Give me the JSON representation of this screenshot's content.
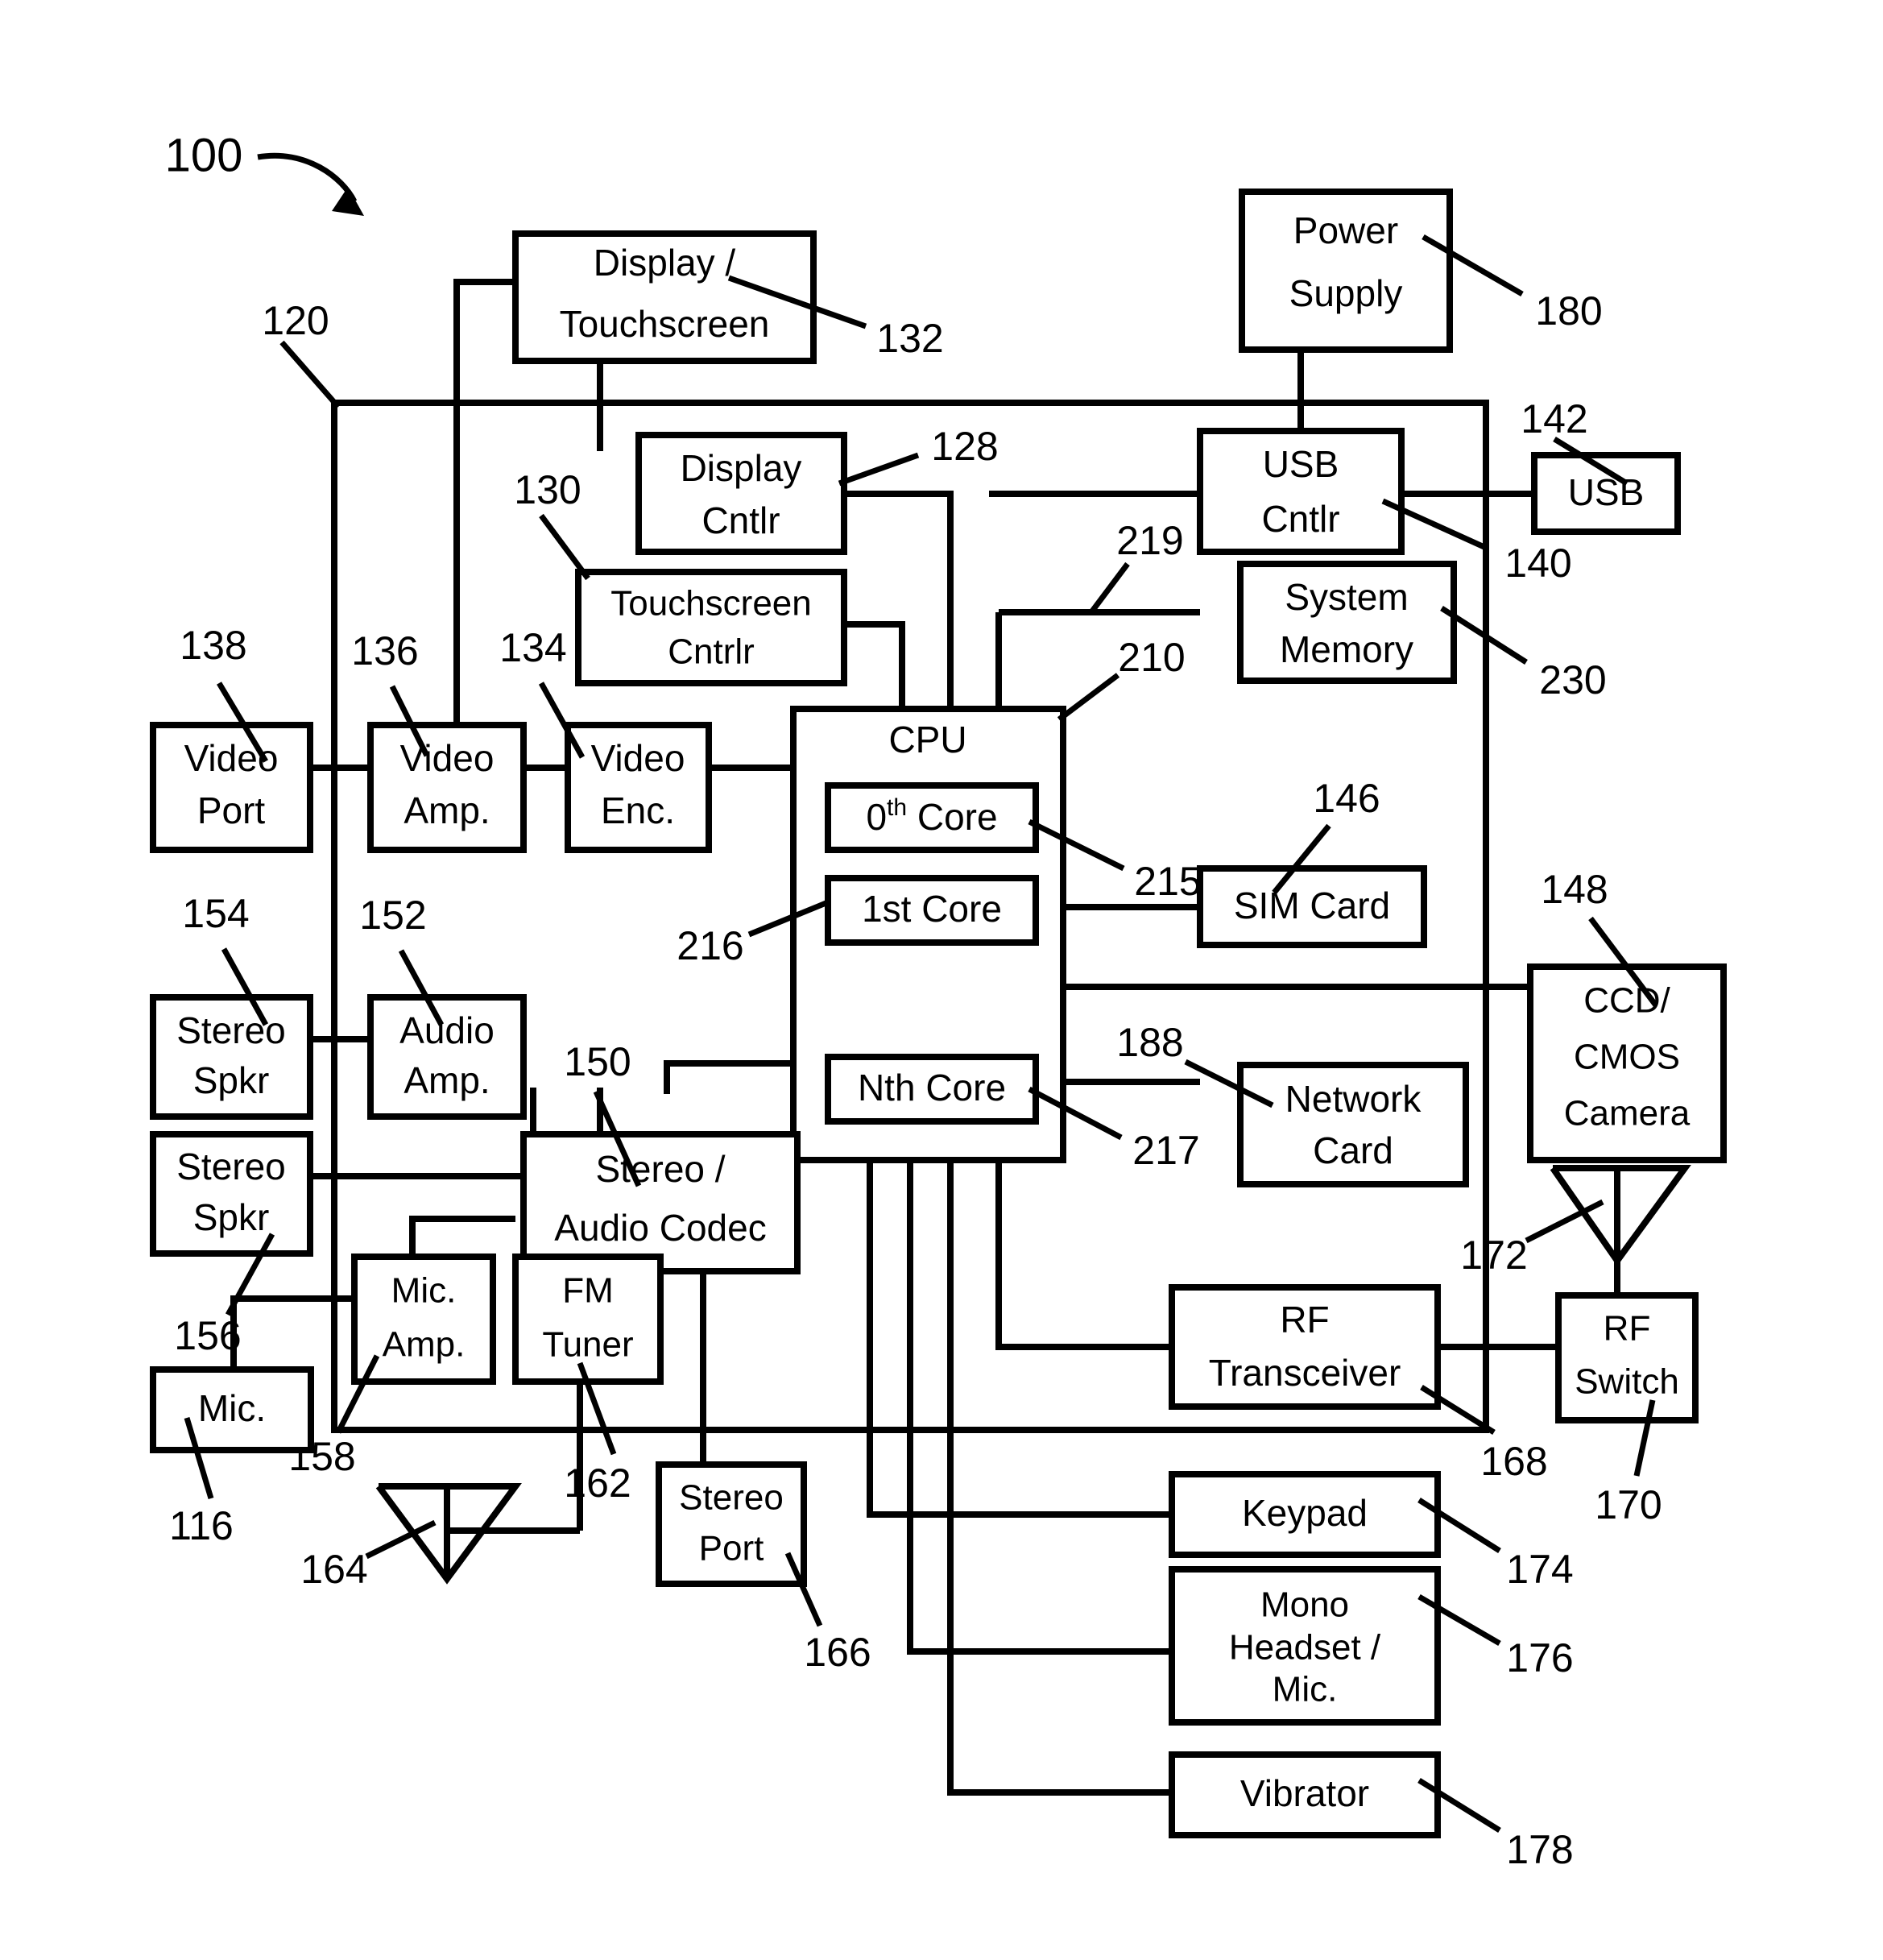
{
  "figure": {
    "main_ref": "100",
    "system_ref": "120"
  },
  "blocks": {
    "display_touchscreen": {
      "line1": "Display /",
      "line2": "Touchscreen",
      "ref": "132"
    },
    "power_supply": {
      "line1": "Power",
      "line2": "Supply",
      "ref": "180"
    },
    "display_cntlr": {
      "line1": "Display",
      "line2": "Cntlr",
      "ref": "128"
    },
    "usb_cntlr": {
      "line1": "USB",
      "line2": "Cntlr",
      "ref": "140"
    },
    "usb": {
      "line1": "USB",
      "ref": "142"
    },
    "touchscreen_cntlr": {
      "line1": "Touchscreen",
      "line2": "Cntrlr",
      "ref": "130"
    },
    "system_memory": {
      "line1": "System",
      "line2": "Memory",
      "ref": "230"
    },
    "memory_bus_ref": "219",
    "cpu": {
      "title": "CPU",
      "ref": "210"
    },
    "core0": {
      "prefix": "0",
      "sup": "th",
      "suffix": " Core",
      "full": "0th Core",
      "ref": "215"
    },
    "core1": {
      "label": "1st Core",
      "ref": "216"
    },
    "coreN": {
      "label": "Nth Core",
      "ref": "217"
    },
    "video_port": {
      "line1": "Video",
      "line2": "Port",
      "ref": "138"
    },
    "video_amp": {
      "line1": "Video",
      "line2": "Amp.",
      "ref": "136"
    },
    "video_enc": {
      "line1": "Video",
      "line2": "Enc.",
      "ref": "134"
    },
    "sim_card": {
      "line1": "SIM Card",
      "ref": "146"
    },
    "ccd_cmos_camera": {
      "line1": "CCD/",
      "line2": "CMOS",
      "line3": "Camera",
      "ref": "148"
    },
    "stereo_spkr_1": {
      "line1": "Stereo",
      "line2": "Spkr",
      "ref": "154"
    },
    "stereo_spkr_2": {
      "line1": "Stereo",
      "line2": "Spkr",
      "ref": "156"
    },
    "audio_amp": {
      "line1": "Audio",
      "line2": "Amp.",
      "ref": "152"
    },
    "stereo_audio_codec": {
      "line1": "Stereo /",
      "line2": "Audio Codec",
      "ref": "150"
    },
    "network_card": {
      "line1": "Network",
      "line2": "Card",
      "ref": "188"
    },
    "mic_amp": {
      "line1": "Mic.",
      "line2": "Amp.",
      "ref": "158"
    },
    "mic": {
      "line1": "Mic.",
      "ref": "116"
    },
    "fm_tuner": {
      "line1": "FM",
      "line2": "Tuner",
      "ref": "162"
    },
    "fm_antenna": {
      "ref": "164"
    },
    "stereo_port": {
      "line1": "Stereo",
      "line2": "Port",
      "ref": "166"
    },
    "rf_transceiver": {
      "line1": "RF",
      "line2": "Transceiver",
      "ref": "168"
    },
    "rf_switch": {
      "line1": "RF",
      "line2": "Switch",
      "ref": "170"
    },
    "rf_antenna": {
      "ref": "172"
    },
    "keypad": {
      "line1": "Keypad",
      "ref": "174"
    },
    "mono_headset": {
      "line1": "Mono",
      "line2": "Headset /",
      "line3": "Mic.",
      "ref": "176"
    },
    "vibrator": {
      "line1": "Vibrator",
      "ref": "178"
    }
  },
  "colors": {
    "stroke": "#000000",
    "background": "#ffffff"
  }
}
